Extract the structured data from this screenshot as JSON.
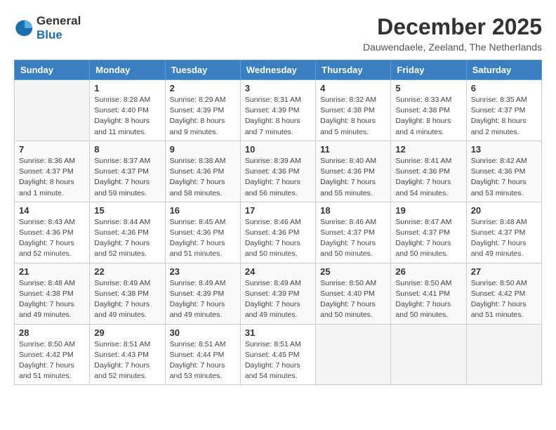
{
  "logo": {
    "general": "General",
    "blue": "Blue"
  },
  "title": "December 2025",
  "location": "Dauwendaele, Zeeland, The Netherlands",
  "weekdays": [
    "Sunday",
    "Monday",
    "Tuesday",
    "Wednesday",
    "Thursday",
    "Friday",
    "Saturday"
  ],
  "weeks": [
    [
      {
        "day": "",
        "info": ""
      },
      {
        "day": "1",
        "info": "Sunrise: 8:28 AM\nSunset: 4:40 PM\nDaylight: 8 hours\nand 11 minutes."
      },
      {
        "day": "2",
        "info": "Sunrise: 8:29 AM\nSunset: 4:39 PM\nDaylight: 8 hours\nand 9 minutes."
      },
      {
        "day": "3",
        "info": "Sunrise: 8:31 AM\nSunset: 4:39 PM\nDaylight: 8 hours\nand 7 minutes."
      },
      {
        "day": "4",
        "info": "Sunrise: 8:32 AM\nSunset: 4:38 PM\nDaylight: 8 hours\nand 5 minutes."
      },
      {
        "day": "5",
        "info": "Sunrise: 8:33 AM\nSunset: 4:38 PM\nDaylight: 8 hours\nand 4 minutes."
      },
      {
        "day": "6",
        "info": "Sunrise: 8:35 AM\nSunset: 4:37 PM\nDaylight: 8 hours\nand 2 minutes."
      }
    ],
    [
      {
        "day": "7",
        "info": "Sunrise: 8:36 AM\nSunset: 4:37 PM\nDaylight: 8 hours\nand 1 minute."
      },
      {
        "day": "8",
        "info": "Sunrise: 8:37 AM\nSunset: 4:37 PM\nDaylight: 7 hours\nand 59 minutes."
      },
      {
        "day": "9",
        "info": "Sunrise: 8:38 AM\nSunset: 4:36 PM\nDaylight: 7 hours\nand 58 minutes."
      },
      {
        "day": "10",
        "info": "Sunrise: 8:39 AM\nSunset: 4:36 PM\nDaylight: 7 hours\nand 56 minutes."
      },
      {
        "day": "11",
        "info": "Sunrise: 8:40 AM\nSunset: 4:36 PM\nDaylight: 7 hours\nand 55 minutes."
      },
      {
        "day": "12",
        "info": "Sunrise: 8:41 AM\nSunset: 4:36 PM\nDaylight: 7 hours\nand 54 minutes."
      },
      {
        "day": "13",
        "info": "Sunrise: 8:42 AM\nSunset: 4:36 PM\nDaylight: 7 hours\nand 53 minutes."
      }
    ],
    [
      {
        "day": "14",
        "info": "Sunrise: 8:43 AM\nSunset: 4:36 PM\nDaylight: 7 hours\nand 52 minutes."
      },
      {
        "day": "15",
        "info": "Sunrise: 8:44 AM\nSunset: 4:36 PM\nDaylight: 7 hours\nand 52 minutes."
      },
      {
        "day": "16",
        "info": "Sunrise: 8:45 AM\nSunset: 4:36 PM\nDaylight: 7 hours\nand 51 minutes."
      },
      {
        "day": "17",
        "info": "Sunrise: 8:46 AM\nSunset: 4:36 PM\nDaylight: 7 hours\nand 50 minutes."
      },
      {
        "day": "18",
        "info": "Sunrise: 8:46 AM\nSunset: 4:37 PM\nDaylight: 7 hours\nand 50 minutes."
      },
      {
        "day": "19",
        "info": "Sunrise: 8:47 AM\nSunset: 4:37 PM\nDaylight: 7 hours\nand 50 minutes."
      },
      {
        "day": "20",
        "info": "Sunrise: 8:48 AM\nSunset: 4:37 PM\nDaylight: 7 hours\nand 49 minutes."
      }
    ],
    [
      {
        "day": "21",
        "info": "Sunrise: 8:48 AM\nSunset: 4:38 PM\nDaylight: 7 hours\nand 49 minutes."
      },
      {
        "day": "22",
        "info": "Sunrise: 8:49 AM\nSunset: 4:38 PM\nDaylight: 7 hours\nand 49 minutes."
      },
      {
        "day": "23",
        "info": "Sunrise: 8:49 AM\nSunset: 4:39 PM\nDaylight: 7 hours\nand 49 minutes."
      },
      {
        "day": "24",
        "info": "Sunrise: 8:49 AM\nSunset: 4:39 PM\nDaylight: 7 hours\nand 49 minutes."
      },
      {
        "day": "25",
        "info": "Sunrise: 8:50 AM\nSunset: 4:40 PM\nDaylight: 7 hours\nand 50 minutes."
      },
      {
        "day": "26",
        "info": "Sunrise: 8:50 AM\nSunset: 4:41 PM\nDaylight: 7 hours\nand 50 minutes."
      },
      {
        "day": "27",
        "info": "Sunrise: 8:50 AM\nSunset: 4:42 PM\nDaylight: 7 hours\nand 51 minutes."
      }
    ],
    [
      {
        "day": "28",
        "info": "Sunrise: 8:50 AM\nSunset: 4:42 PM\nDaylight: 7 hours\nand 51 minutes."
      },
      {
        "day": "29",
        "info": "Sunrise: 8:51 AM\nSunset: 4:43 PM\nDaylight: 7 hours\nand 52 minutes."
      },
      {
        "day": "30",
        "info": "Sunrise: 8:51 AM\nSunset: 4:44 PM\nDaylight: 7 hours\nand 53 minutes."
      },
      {
        "day": "31",
        "info": "Sunrise: 8:51 AM\nSunset: 4:45 PM\nDaylight: 7 hours\nand 54 minutes."
      },
      {
        "day": "",
        "info": ""
      },
      {
        "day": "",
        "info": ""
      },
      {
        "day": "",
        "info": ""
      }
    ]
  ]
}
